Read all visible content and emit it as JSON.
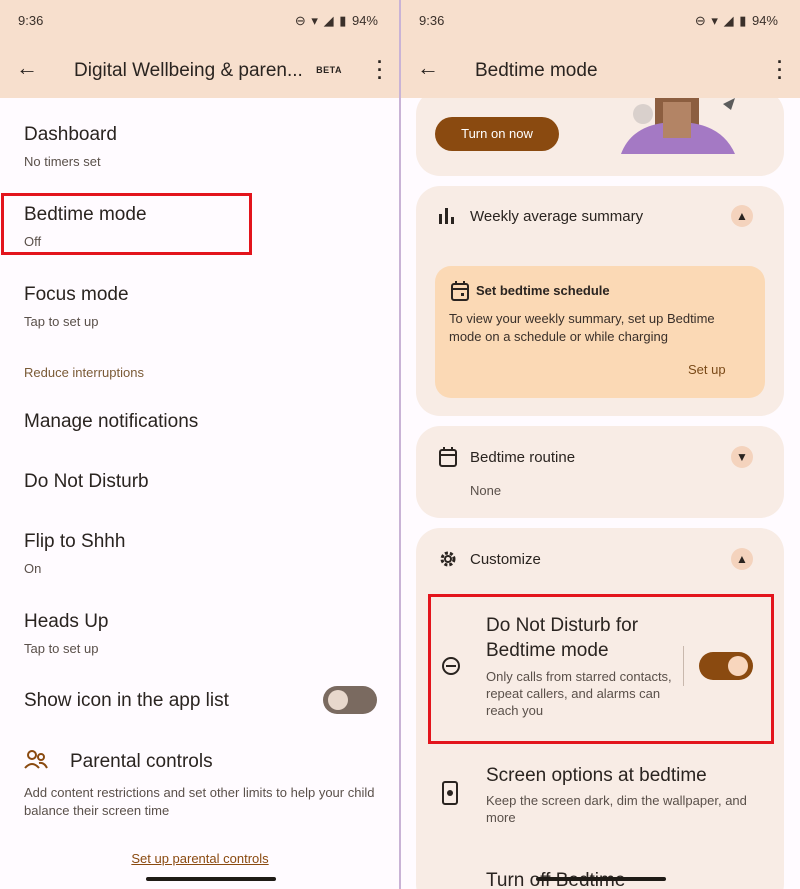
{
  "status": {
    "time": "9:36",
    "battery": "94%"
  },
  "left": {
    "title": "Digital Wellbeing & paren...",
    "badge": "BETA",
    "items": [
      {
        "title": "Dashboard",
        "subtitle": "No timers set"
      },
      {
        "title": "Bedtime mode",
        "subtitle": "Off"
      },
      {
        "title": "Focus mode",
        "subtitle": "Tap to set up"
      }
    ],
    "section_label": "Reduce interruptions",
    "items2": [
      {
        "title": "Manage notifications"
      },
      {
        "title": "Do Not Disturb"
      },
      {
        "title": "Flip to Shhh",
        "subtitle": "On"
      },
      {
        "title": "Heads Up",
        "subtitle": "Tap to set up"
      }
    ],
    "show_icon_label": "Show icon in the app list",
    "parental": {
      "title": "Parental controls",
      "description": "Add content restrictions and set other limits to help your child balance their screen time",
      "link": "Set up parental controls"
    }
  },
  "right": {
    "title": "Bedtime mode",
    "turn_on_now": "Turn on now",
    "weekly": {
      "title": "Weekly average summary",
      "schedule_title": "Set bedtime schedule",
      "schedule_text": "To view your weekly summary, set up Bedtime mode on a schedule or while charging",
      "setup": "Set up"
    },
    "routine": {
      "title": "Bedtime routine",
      "value": "None"
    },
    "customize": {
      "title": "Customize",
      "dnd_title": "Do Not Disturb for Bedtime mode",
      "dnd_desc": "Only calls from starred contacts, repeat callers, and alarms can reach you",
      "screen_title": "Screen options at bedtime",
      "screen_desc": "Keep the screen dark, dim the wallpaper, and more",
      "turn_off": "Turn off Bedtime"
    }
  },
  "colors": {
    "appbar": "#f7dfcd",
    "accent": "#8a4a10",
    "highlight": "#e3141c",
    "card": "#f8ece5",
    "schedule_card": "#fbd9b5"
  }
}
